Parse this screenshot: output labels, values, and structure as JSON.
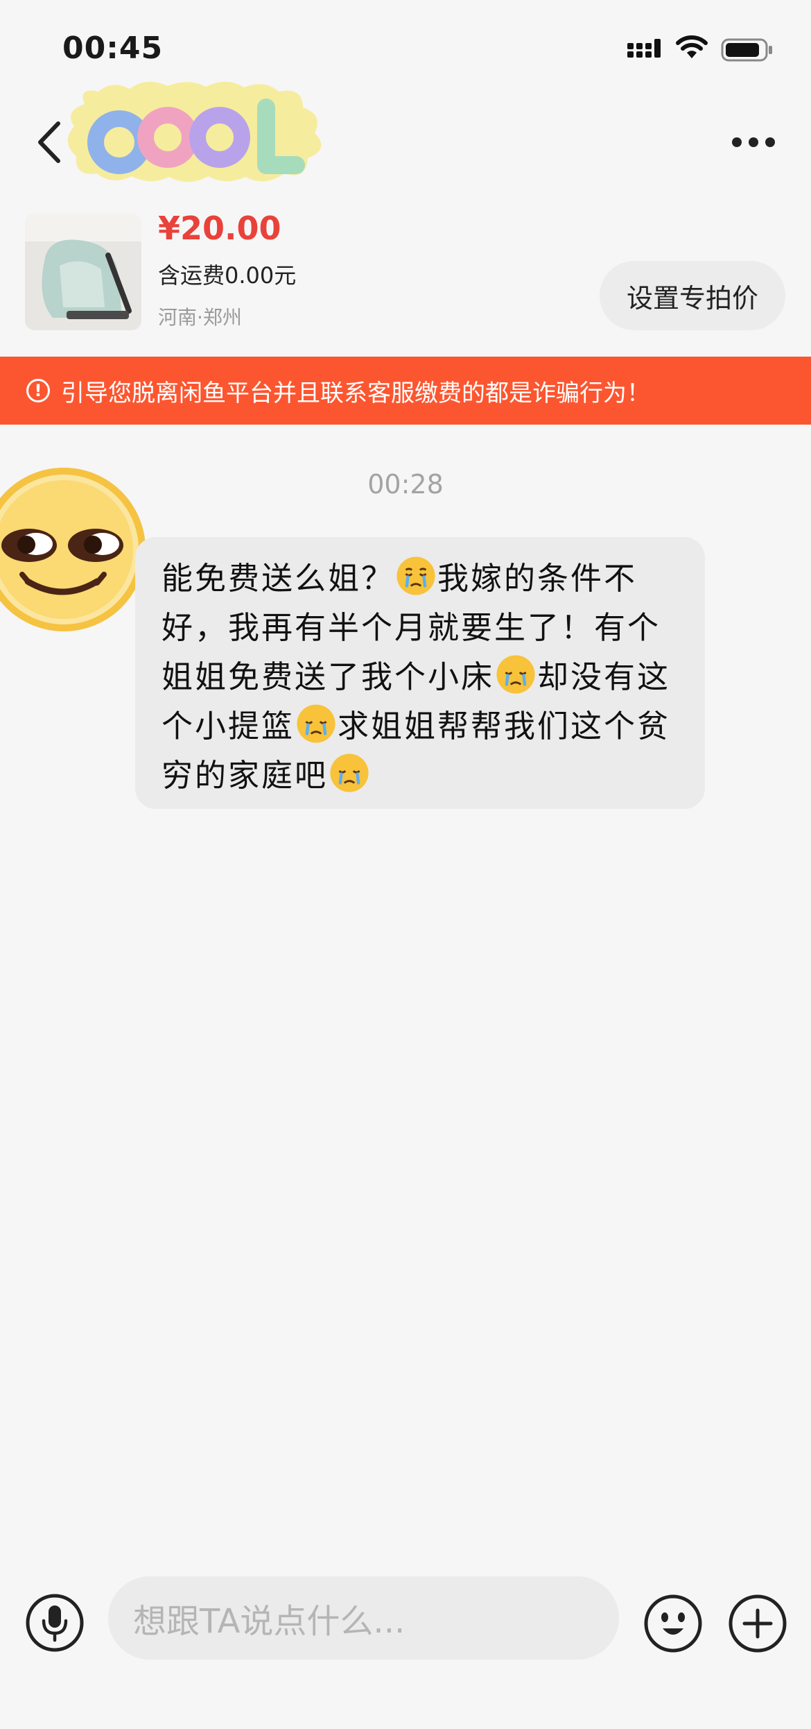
{
  "status_bar": {
    "time": "00:45"
  },
  "header": {
    "badge_text": "COOL"
  },
  "product": {
    "price": "¥20.00",
    "shipping": "含运费0.00元",
    "location": "河南·郑州",
    "set_price_button": "设置专拍价"
  },
  "warning": {
    "icon": "!",
    "text": "引导您脱离闲鱼平台并且联系客服缴费的都是诈骗行为！"
  },
  "chat": {
    "timestamp": "00:28",
    "message": {
      "part1": "能免费送么姐？",
      "part2": "我嫁的条件不好，我再有半个月就要生了！有个姐姐免费送了我个小床",
      "part3": "却没有这个小提篮",
      "part4": "求姐姐帮帮我们这个贫穷的家庭吧",
      "emoji": "crying-sad-face"
    }
  },
  "input_bar": {
    "placeholder": "想跟TA说点什么..."
  },
  "colors": {
    "accent_red": "#e8423a",
    "banner": "#fc5630",
    "background": "#f6f6f6",
    "bubble": "#ebebeb"
  }
}
